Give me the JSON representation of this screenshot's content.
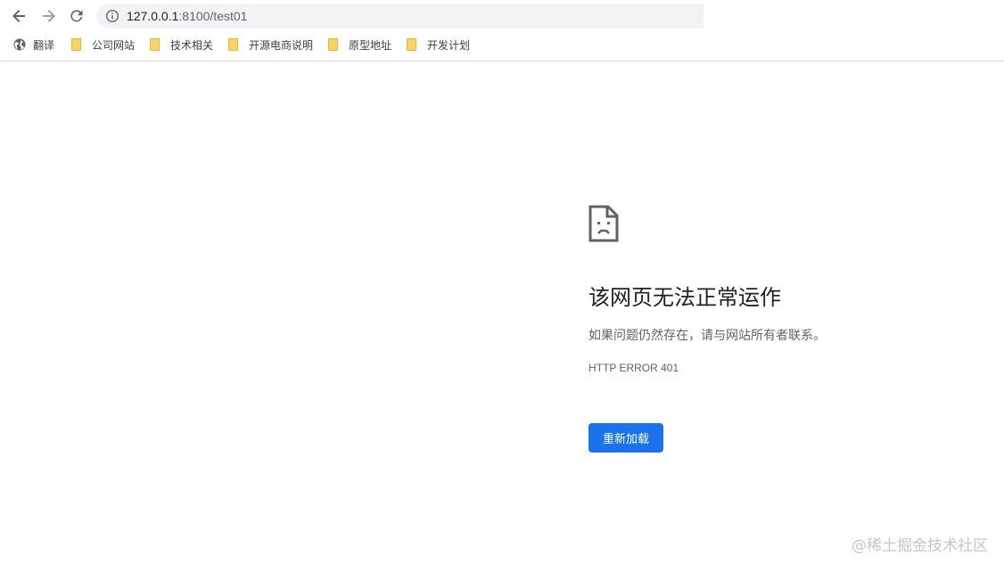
{
  "browser": {
    "url_host": "127.0.0.1",
    "url_path": ":8100/test01",
    "bookmarks": [
      {
        "label": "翻译",
        "icon": "globe-icon"
      },
      {
        "label": "公司网站",
        "icon": "folder-icon"
      },
      {
        "label": "技术相关",
        "icon": "folder-icon"
      },
      {
        "label": "开源电商说明",
        "icon": "folder-icon"
      },
      {
        "label": "原型地址",
        "icon": "folder-icon"
      },
      {
        "label": "开发计划",
        "icon": "folder-icon"
      }
    ]
  },
  "error_page": {
    "icon": "broken-page-icon",
    "title": "该网页无法正常运作",
    "description": "如果问题仍然存在，请与网站所有者联系。",
    "error_code": "HTTP ERROR 401",
    "reload_label": "重新加载"
  },
  "watermark": "@稀土掘金技术社区",
  "colors": {
    "accent": "#1a73e8",
    "text": "#202124",
    "muted": "#5f6368",
    "omnibox_bg": "#f1f3f4",
    "folder": "#f7d463"
  }
}
